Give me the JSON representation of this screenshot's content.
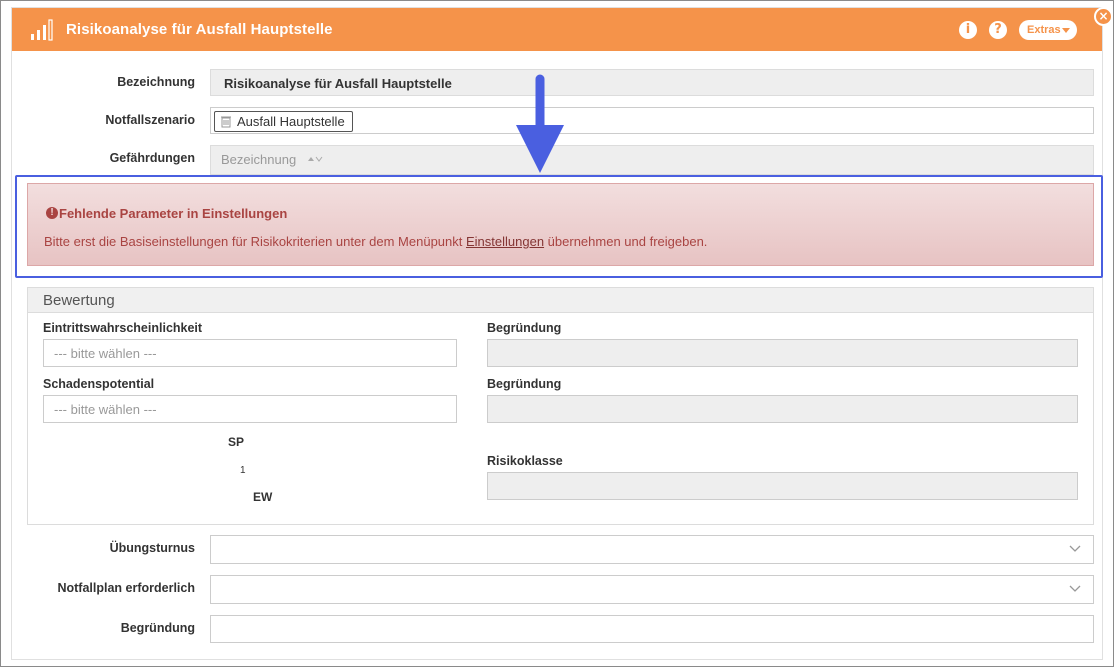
{
  "window": {
    "title": "Risikoanalyse für Ausfall Hauptstelle",
    "info_button": "i",
    "help_button": "?",
    "extras_label": "Extras",
    "close_label": "×",
    "accent_color": "#f5934a"
  },
  "form": {
    "bezeichnung_label": "Bezeichnung",
    "bezeichnung_value": "Risikoanalyse für Ausfall Hauptstelle",
    "notfallszenario_label": "Notfallszenario",
    "notfallszenario_tag": "Ausfall Hauptstelle",
    "gefaehrdungen_label": "Gefährdungen",
    "gefaehrdungen_column": "Bezeichnung"
  },
  "alert": {
    "title": "Fehlende Parameter in Einstellungen",
    "text_before": "Bitte erst die Basiseinstellungen für Risikokriterien unter dem Menüpunkt ",
    "link": "Einstellungen",
    "text_after": " übernehmen und freigeben.",
    "color": "#a94442"
  },
  "bewertung": {
    "heading": "Bewertung",
    "eintritt_label": "Eintrittswahrscheinlichkeit",
    "eintritt_placeholder": "--- bitte wählen ---",
    "begruendung1_label": "Begründung",
    "schaden_label": "Schadenspotential",
    "schaden_placeholder": "--- bitte wählen ---",
    "begruendung2_label": "Begründung",
    "sp_label": "SP",
    "matrix_value": "1",
    "ew_label": "EW",
    "risikoklasse_label": "Risikoklasse"
  },
  "bottom": {
    "uebungsturnus_label": "Übungsturnus",
    "notfallplan_label": "Notfallplan erforderlich",
    "begruendung_label": "Begründung"
  }
}
